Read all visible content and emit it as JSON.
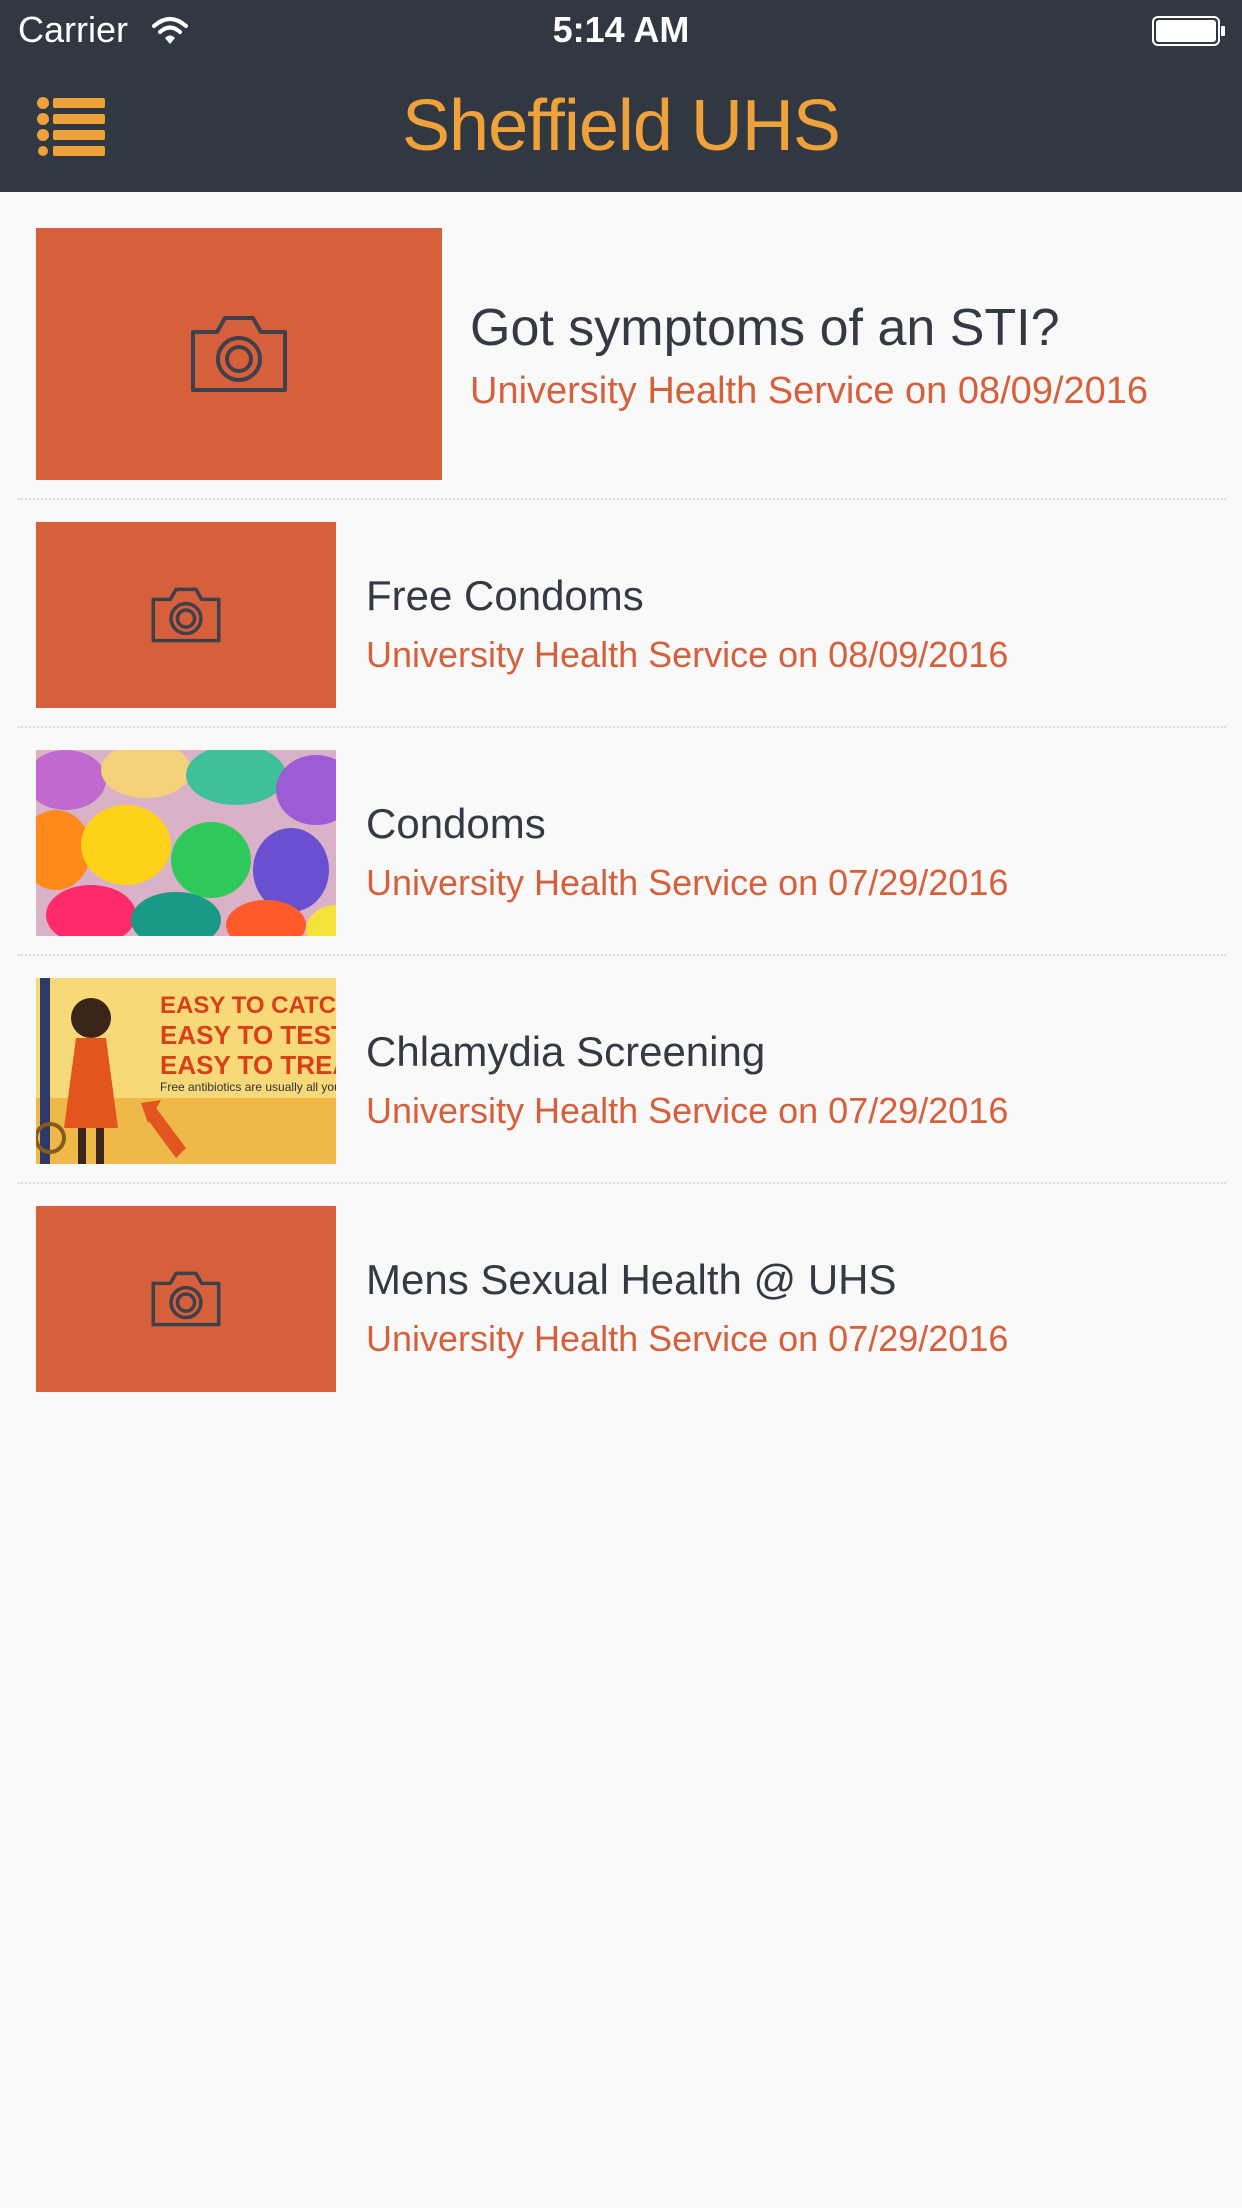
{
  "status_bar": {
    "carrier": "Carrier",
    "time": "5:14 AM",
    "wifi_icon": "wifi-icon",
    "battery_icon": "battery-icon"
  },
  "nav": {
    "title": "Sheffield UHS",
    "menu_icon": "list-menu-icon",
    "title_color": "#f0a23a",
    "bar_color": "#323841"
  },
  "colors": {
    "accent": "#d5603b",
    "text": "#353a42",
    "background": "#f9f9f9"
  },
  "posts": [
    {
      "title": "Got symptoms of an STI?",
      "meta": "University Health Service on 08/09/2016",
      "thumbnail": "camera-placeholder-icon"
    },
    {
      "title": "Free Condoms",
      "meta": "University Health Service on 08/09/2016",
      "thumbnail": "camera-placeholder-icon"
    },
    {
      "title": "Condoms",
      "meta": "University Health Service on 07/29/2016",
      "thumbnail": "colorful-condoms-photo"
    },
    {
      "title": "Chlamydia Screening",
      "meta": "University Health Service on 07/29/2016",
      "thumbnail": "chlamydia-poster-image",
      "poster_lines": [
        "EASY TO CATCH",
        "EASY TO TEST",
        "EASY TO TREAT",
        "Free antibiotics are usually all you need"
      ]
    },
    {
      "title": "Mens Sexual Health @ UHS",
      "meta": "University Health Service on 07/29/2016",
      "thumbnail": "camera-placeholder-icon"
    }
  ]
}
